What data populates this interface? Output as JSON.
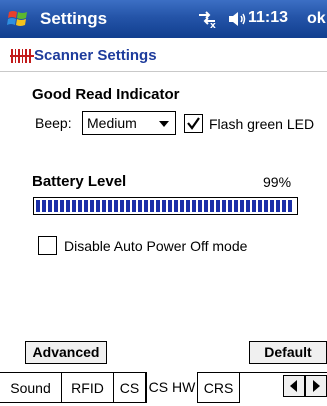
{
  "titlebar": {
    "title": "Settings",
    "time": "11:13",
    "ok_label": "ok",
    "icons": [
      "windows-start-icon",
      "connectivity-icon",
      "volume-icon"
    ]
  },
  "header": {
    "title": "Scanner Settings",
    "icon": "scanner-barcode-icon",
    "title_color": "#1e3c9c"
  },
  "good_read": {
    "title": "Good Read Indicator",
    "beep_label": "Beep:",
    "beep_value": "Medium",
    "flash_label": "Flash green LED",
    "flash_checked": true
  },
  "battery": {
    "title": "Battery Level",
    "percent_text": "99%",
    "level": 0.99
  },
  "auto_power": {
    "label": "Disable Auto Power Off mode",
    "checked": false
  },
  "buttons": {
    "advanced": "Advanced",
    "default": "Default"
  },
  "tabs": [
    {
      "label": "Sound",
      "active": false
    },
    {
      "label": "RFID",
      "active": false
    },
    {
      "label": "CS",
      "active": false
    },
    {
      "label": "CS HW",
      "active": true
    },
    {
      "label": "CRS",
      "active": false
    }
  ],
  "colors": {
    "titlebar": "#2454a8",
    "battery_fill": "#1b2fa8"
  }
}
